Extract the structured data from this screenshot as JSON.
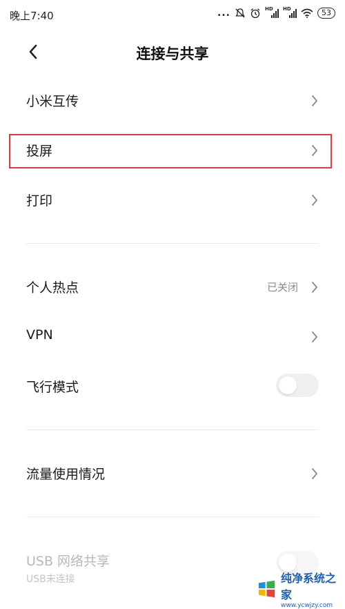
{
  "status_bar": {
    "time": "晚上7:40",
    "dots": "...",
    "hd1": "HD",
    "hd2": "HD",
    "battery": "53",
    "icons": [
      "mute-icon",
      "alarm-icon",
      "signal-icon",
      "signal-icon",
      "wifi-icon",
      "battery-icon"
    ]
  },
  "header": {
    "title": "连接与共享",
    "back_icon": "chevron-left-icon"
  },
  "items": {
    "mi_transfer": {
      "label": "小米互传"
    },
    "cast": {
      "label": "投屏"
    },
    "print": {
      "label": "打印"
    },
    "hotspot": {
      "label": "个人热点",
      "value": "已关闭"
    },
    "vpn": {
      "label": "VPN"
    },
    "airplane": {
      "label": "飞行模式",
      "enabled": false
    },
    "data_usage": {
      "label": "流量使用情况"
    },
    "usb_tether": {
      "label": "USB 网络共享",
      "sub": "USB未连接",
      "enabled": false
    }
  },
  "watermark": {
    "brand": "纯净系统之家",
    "url": "www.ycwjzy.com"
  },
  "colors": {
    "highlight": "#e03a3a",
    "text": "#1a1a1a",
    "secondary": "#8a8a8a",
    "watermark": "#1d5fb8"
  }
}
